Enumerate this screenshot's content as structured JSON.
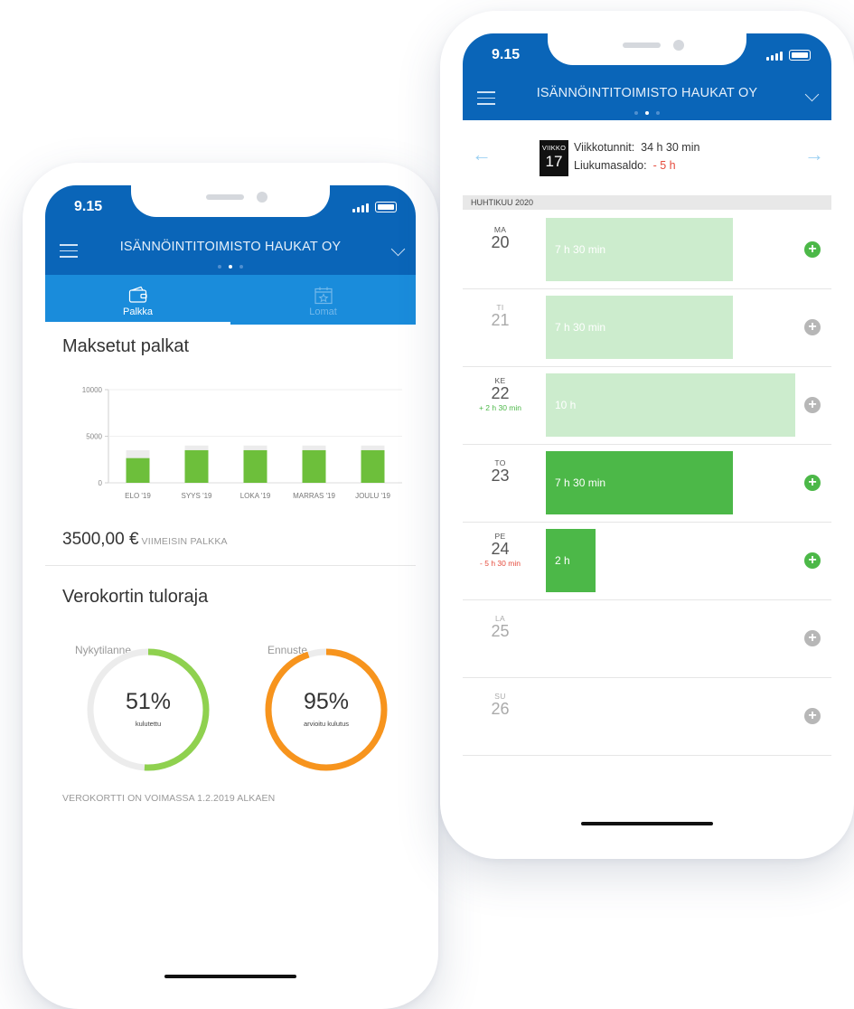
{
  "left_phone": {
    "status_time": "9.15",
    "company": "ISÄNNÖINTITOIMISTO HAUKAT OY",
    "tabs": [
      {
        "label": "Palkka",
        "icon": "wallet-icon",
        "active": true
      },
      {
        "label": "Lomat",
        "icon": "calendar-star-icon",
        "active": false
      }
    ],
    "salaries": {
      "title": "Maksetut palkat",
      "latest_amount": "3500,00 €",
      "latest_label": "VIIMEISIN PALKKA"
    },
    "tax_card": {
      "title": "Verokortin tuloraja",
      "current": {
        "label": "Nykytilanne",
        "percent_text": "51%",
        "percent": 51,
        "caption": "kulutettu",
        "color": "#8fd14f"
      },
      "forecast": {
        "label": "Ennuste",
        "percent_text": "95%",
        "percent": 95,
        "caption": "arvioitu kulutus",
        "color": "#f7941d"
      },
      "validity": "VEROKORTTI ON VOIMASSA 1.2.2019 ALKAEN"
    }
  },
  "chart_data": {
    "type": "bar",
    "categories": [
      "ELO '19",
      "SYYS '19",
      "LOKA '19",
      "MARRAS '19",
      "JOULU '19"
    ],
    "series": [
      {
        "values": [
          2650,
          3500,
          3500,
          3500,
          3500
        ],
        "color": "#6dbf3b"
      },
      {
        "values": [
          3500,
          4000,
          4000,
          4000,
          4000
        ],
        "color": "#ececec"
      }
    ],
    "ylim": [
      0,
      10000
    ],
    "yticks": [
      0,
      5000,
      10000
    ],
    "ytick_labels": [
      "0",
      "5000",
      "10000"
    ],
    "grid": true
  },
  "right_phone": {
    "status_time": "9.15",
    "company": "ISÄNNÖINTITOIMISTO HAUKAT OY",
    "week": {
      "badge_label": "VIIKKO",
      "number": "17",
      "hours_label": "Viikkotunnit:",
      "hours_value": "34 h 30 min",
      "flex_label": "Liukumasaldo:",
      "flex_value": "- 5 h"
    },
    "month": "HUHTIKUU 2020",
    "days": [
      {
        "name": "MA",
        "date": "20",
        "flex": "",
        "flex_color": "",
        "hours": "7 h 30 min",
        "fill": 0.75,
        "bar_color": "#cceccd",
        "text_color": "#ffffff",
        "label_color": "#555555",
        "plus_color": "#4cb848"
      },
      {
        "name": "TI",
        "date": "21",
        "flex": "",
        "flex_color": "",
        "hours": "7 h 30 min",
        "fill": 0.75,
        "bar_color": "#cceccd",
        "text_color": "#ffffff",
        "label_color": "#aaaaaa",
        "plus_color": "#b7b7b7"
      },
      {
        "name": "KE",
        "date": "22",
        "flex": "+ 2 h 30 min",
        "flex_color": "#4cb848",
        "hours": "10 h",
        "fill": 1.0,
        "bar_color": "#cceccd",
        "text_color": "#ffffff",
        "label_color": "#555555",
        "plus_color": "#b7b7b7"
      },
      {
        "name": "TO",
        "date": "23",
        "flex": "",
        "flex_color": "",
        "hours": "7 h 30 min",
        "fill": 0.75,
        "bar_color": "#4cb848",
        "text_color": "#ffffff",
        "label_color": "#555555",
        "plus_color": "#4cb848"
      },
      {
        "name": "PE",
        "date": "24",
        "flex": "- 5 h 30 min",
        "flex_color": "#e54b3c",
        "hours": "2 h",
        "fill": 0.2,
        "bar_color": "#4cb848",
        "text_color": "#ffffff",
        "label_color": "#555555",
        "plus_color": "#4cb848"
      },
      {
        "name": "LA",
        "date": "25",
        "flex": "",
        "flex_color": "",
        "hours": "",
        "fill": 0,
        "bar_color": "",
        "text_color": "",
        "label_color": "#aaaaaa",
        "plus_color": "#b7b7b7"
      },
      {
        "name": "SU",
        "date": "26",
        "flex": "",
        "flex_color": "",
        "hours": "",
        "fill": 0,
        "bar_color": "",
        "text_color": "",
        "label_color": "#aaaaaa",
        "plus_color": "#b7b7b7"
      }
    ]
  }
}
